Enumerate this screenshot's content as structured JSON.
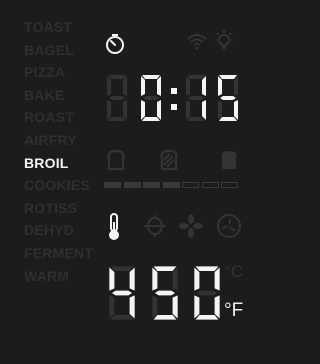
{
  "modes": [
    {
      "label": "TOAST",
      "active": false
    },
    {
      "label": "BAGEL",
      "active": false
    },
    {
      "label": "PIZZA",
      "active": false
    },
    {
      "label": "BAKE",
      "active": false
    },
    {
      "label": "ROAST",
      "active": false
    },
    {
      "label": "AIRFRY",
      "active": false
    },
    {
      "label": "BROIL",
      "active": true
    },
    {
      "label": "COOKIES",
      "active": false
    },
    {
      "label": "ROTISS",
      "active": false
    },
    {
      "label": "DEHYD",
      "active": false
    },
    {
      "label": "FERMENT",
      "active": false
    },
    {
      "label": "WARM",
      "active": false
    }
  ],
  "timer": {
    "ghost_digit": "8",
    "minutes_digit": "0",
    "separator": ":",
    "seconds": "15"
  },
  "temperature": {
    "value": "450",
    "unit_celsius": "°C",
    "unit_fahrenheit": "°F",
    "active_unit": "F"
  },
  "status_icons": [
    "timer-icon",
    "wifi-icon",
    "light-icon"
  ],
  "toast_shade": {
    "levels": 7,
    "active": 4
  },
  "function_icons": [
    "thermometer-icon",
    "rotisserie-icon",
    "convection-fan-icon",
    "fan-icon"
  ],
  "colors": {
    "lit": "#f4f4f4",
    "dim": "#333333",
    "background": "#1c1c1c"
  }
}
